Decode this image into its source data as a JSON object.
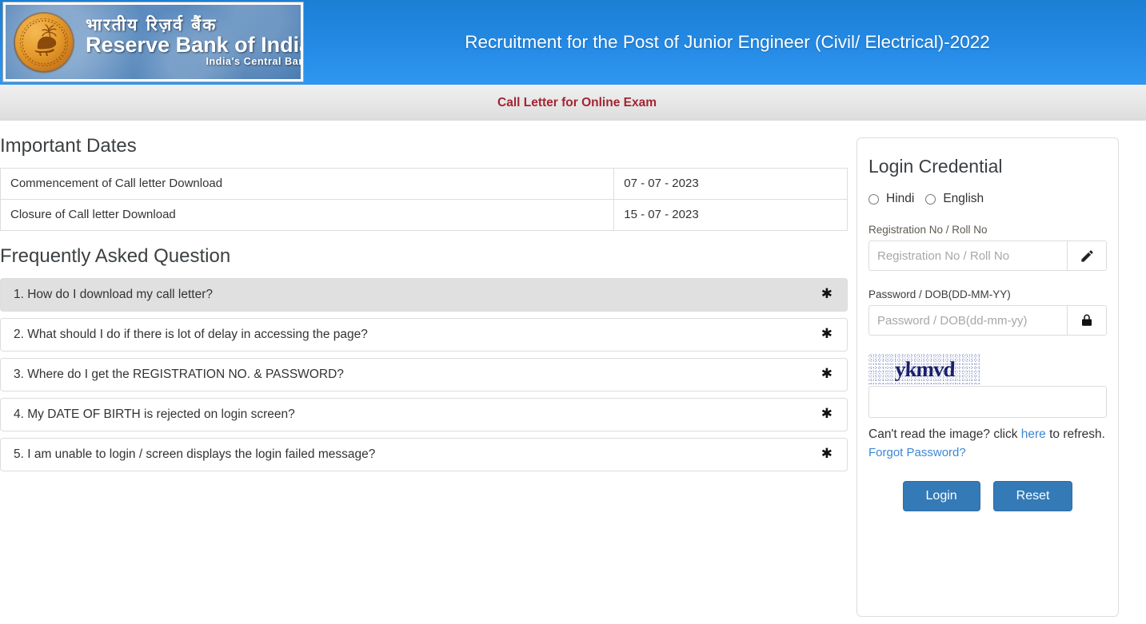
{
  "header": {
    "title": "Recruitment for the Post of Junior Engineer (Civil/ Electrical)-2022",
    "subtitle": "Call Letter for Online Exam",
    "logo": {
      "hindi": "भारतीय  रिज़र्व   बैंक",
      "english": "Reserve Bank of India",
      "tagline": "India's Central Bank",
      "emblem_icon": "rbi-emblem-icon"
    },
    "colors": {
      "banner_from": "#1b7fd4",
      "banner_to": "#2f97f0",
      "subtitle_text": "#a32432"
    }
  },
  "important_dates": {
    "heading": "Important Dates",
    "rows": [
      {
        "label": "Commencement of Call letter Download",
        "value": "07 - 07 - 2023"
      },
      {
        "label": "Closure of Call letter Download",
        "value": "15 - 07 - 2023"
      }
    ]
  },
  "faq": {
    "heading": "Frequently Asked Question",
    "items": [
      {
        "question": "1. How do I download my call letter?",
        "expanded": false,
        "active": true
      },
      {
        "question": "2. What should I do if there is lot of delay in accessing the page?",
        "expanded": false,
        "active": false
      },
      {
        "question": "3. Where do I get the REGISTRATION NO. & PASSWORD?",
        "expanded": false,
        "active": false
      },
      {
        "question": "4. My DATE OF BIRTH is rejected on login screen?",
        "expanded": false,
        "active": false
      },
      {
        "question": "5. I am unable to login / screen displays the login failed message?",
        "expanded": false,
        "active": false
      }
    ],
    "chevron_icon": "chevron-down-icon"
  },
  "login": {
    "title": "Login Credential",
    "language_options": [
      {
        "label": "Hindi",
        "selected": false
      },
      {
        "label": "English",
        "selected": false
      }
    ],
    "registration": {
      "label": "Registration No / Roll No",
      "placeholder": "Registration No / Roll No",
      "value": "",
      "addon_icon": "pencil-icon"
    },
    "password": {
      "label": "Password / DOB(DD-MM-YY)",
      "placeholder": "Password / DOB(dd-mm-yy)",
      "value": "",
      "addon_icon": "lock-icon"
    },
    "captcha": {
      "text": "ykmvd",
      "input_value": "",
      "input_placeholder": "",
      "refresh_prefix": "Can't read the image? click ",
      "refresh_link": "here",
      "refresh_suffix": " to refresh."
    },
    "forgot_password": "Forgot Password?",
    "buttons": {
      "login": "Login",
      "reset": "Reset"
    },
    "colors": {
      "button": "#337ab7",
      "link": "#3b88d6"
    }
  }
}
